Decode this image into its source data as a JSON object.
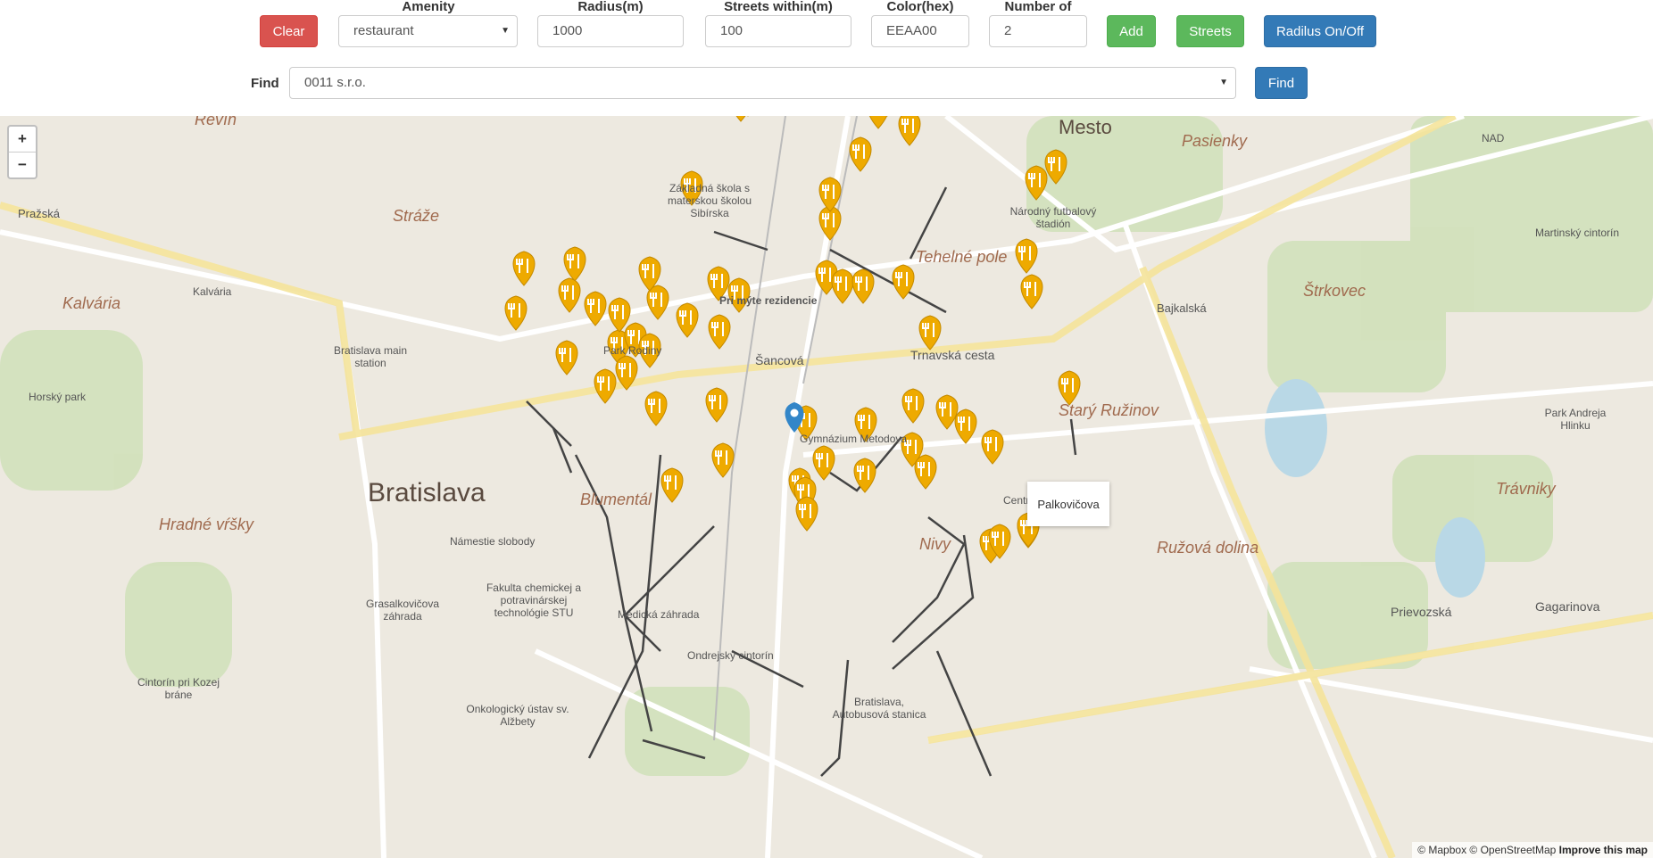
{
  "toolbar": {
    "clear_label": "Clear",
    "amenity_label": "Amenity",
    "amenity_value": "restaurant",
    "radius_label": "Radius(m)",
    "radius_value": "1000",
    "streets_within_label": "Streets within(m)",
    "streets_within_value": "100",
    "color_label": "Color(hex)",
    "color_value": "EEAA00",
    "number_label": "Number of",
    "number_value": "2",
    "add_label": "Add",
    "streets_label": "Streets",
    "radius_toggle_label": "Radilus On/Off",
    "find_label": "Find",
    "find_value": "0011 s.r.o.",
    "find_button_label": "Find"
  },
  "map": {
    "zoom_in": "+",
    "zoom_out": "−",
    "tooltip": "Palkovičova",
    "attribution_prefix": "© Mapbox © OpenStreetMap",
    "attribution_link": "Improve this map",
    "marker_color": "#EEAA00",
    "place_labels": [
      "Mesto",
      "Pasienky",
      "Revín",
      "Stráže",
      "Kalvária",
      "Bratislava",
      "Hradné vŕšky",
      "Tehelné pole",
      "Starý Ružinov",
      "Štrkovec",
      "Ružová dolina",
      "Trávniky",
      "Nivy",
      "Blumentál",
      "Pražská",
      "Šancová",
      "Trnavská cesta",
      "Bajkalská",
      "Prievozská",
      "Gagarinova",
      "Základná škola s materskou školou Sibírska",
      "Pri mýte rezidencie",
      "Gymnázium Metodova",
      "Centrálne trhovisko",
      "Námestie slobody",
      "Fakulta chemickej a potravinárskej technológie STU",
      "Grasalkovičova záhrada",
      "Medická záhrada",
      "Ondrejský cintorín",
      "Cintorín pri Kozej bráne",
      "Onkologický ústav sv. Alžbety",
      "Bratislava, Autobusová stanica",
      "Horský park",
      "Kalvária",
      "Bratislava main station",
      "Národný futbalový štadión",
      "NAD",
      "Martinský cintorín",
      "Park Andreja Hlinku",
      "Park Rodiny"
    ]
  }
}
